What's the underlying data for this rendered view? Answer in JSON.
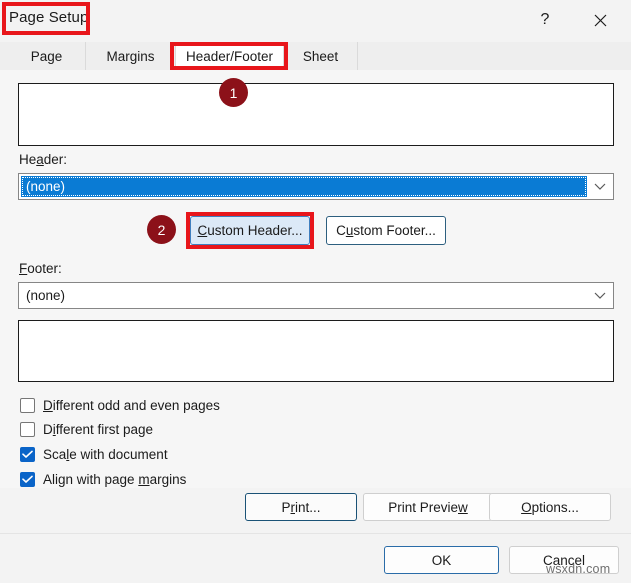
{
  "window": {
    "title": "Page Setup",
    "help_icon": "question-mark-icon",
    "close_icon": "close-icon"
  },
  "tabs": [
    {
      "label": "Page",
      "active": false
    },
    {
      "label": "Margins",
      "active": false
    },
    {
      "label": "Header/Footer",
      "active": true
    },
    {
      "label": "Sheet",
      "active": false
    }
  ],
  "header_section": {
    "label_prefix": "He",
    "label_accel": "a",
    "label_suffix": "der:",
    "label_full": "Header:",
    "value": "(none)",
    "arrow_icon": "chevron-down-icon"
  },
  "footer_section": {
    "label_accel": "F",
    "label_suffix": "ooter:",
    "label_full": "Footer:",
    "value": "(none)",
    "arrow_icon": "chevron-down-icon"
  },
  "custom_buttons": {
    "header": {
      "accel": "C",
      "rest": "ustom Header...",
      "full": "Custom Header..."
    },
    "footer": {
      "pre": "C",
      "accel": "u",
      "rest": "stom Footer...",
      "full": "Custom Footer..."
    }
  },
  "checkboxes": [
    {
      "accel": "D",
      "pre": "",
      "rest": "ifferent odd and even pages",
      "full": "Different odd and even pages",
      "checked": false
    },
    {
      "accel": "i",
      "pre": "D",
      "rest": "fferent first page",
      "full": "Different first page",
      "checked": false
    },
    {
      "accel": "l",
      "pre": "Sca",
      "rest": "e with document",
      "full": "Scale with document",
      "checked": true
    },
    {
      "accel": "m",
      "pre": "Align with page ",
      "rest": "argins",
      "full": "Align with page margins",
      "checked": true
    }
  ],
  "action_buttons": {
    "print": {
      "pre": "P",
      "accel": "r",
      "rest": "int...",
      "full": "Print..."
    },
    "print_preview": {
      "pre": "Print Previe",
      "accel": "w",
      "rest": "",
      "full": "Print Preview"
    },
    "options": {
      "pre": "",
      "accel": "O",
      "rest": "ptions...",
      "full": "Options..."
    }
  },
  "dialog_buttons": {
    "ok": "OK",
    "cancel": "Cancel"
  },
  "annotations": {
    "badge_1": "1",
    "badge_2": "2",
    "highlight_color": "#e8161b",
    "badge_color": "#8c1119"
  },
  "watermark": "wsxdn.com"
}
